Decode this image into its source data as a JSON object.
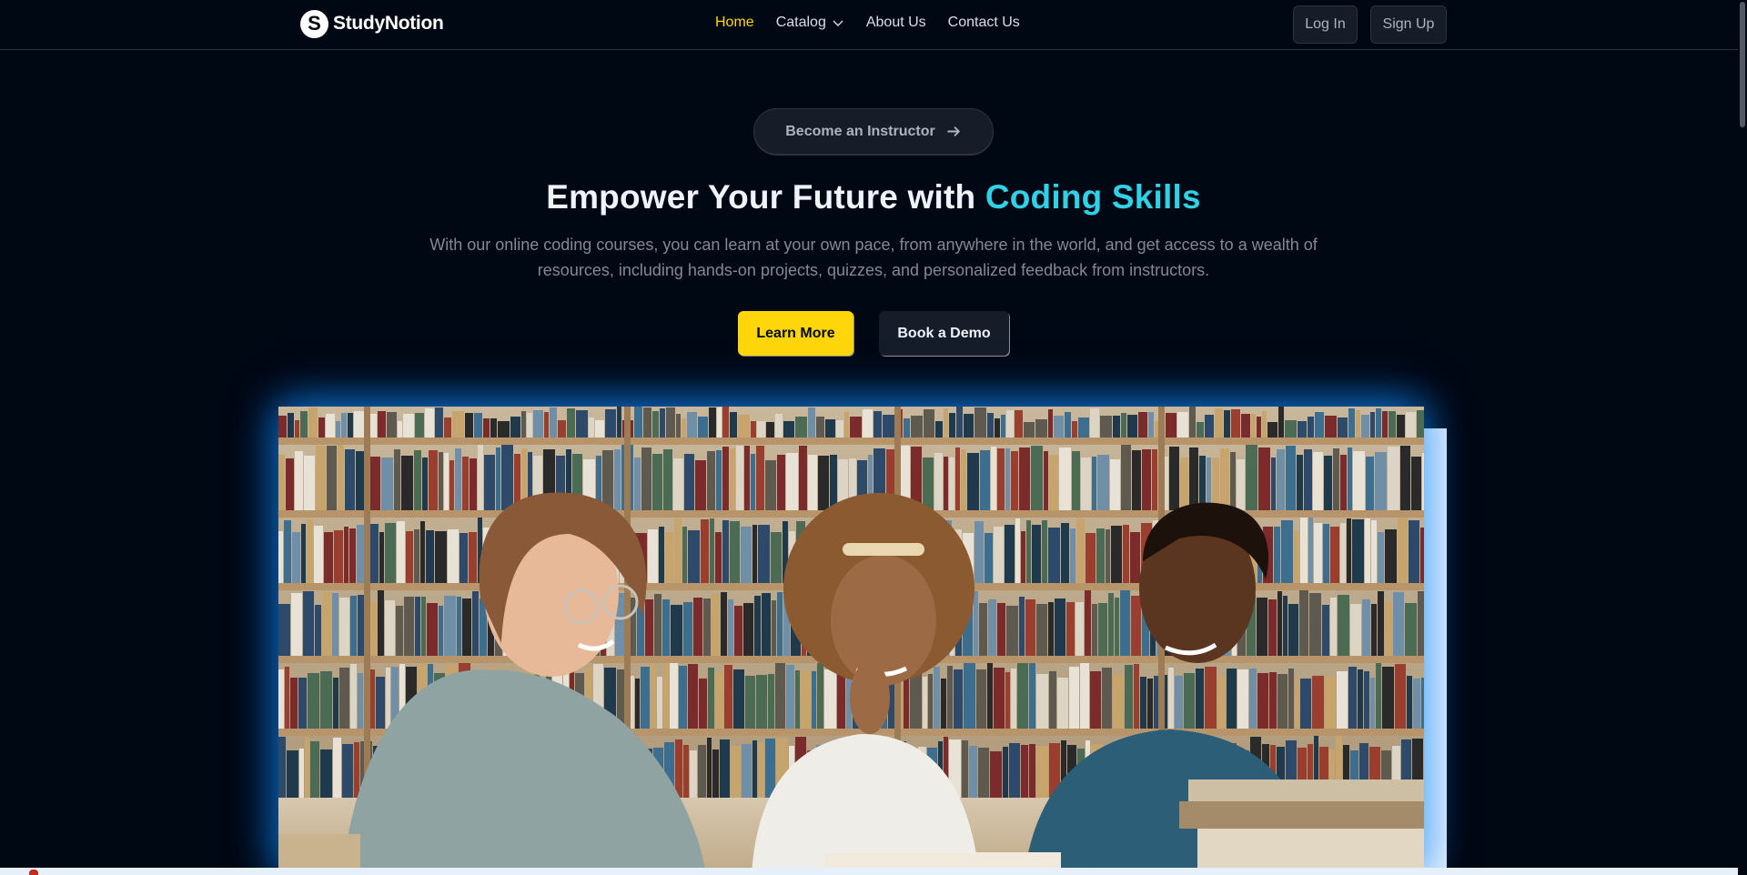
{
  "brand": {
    "logo_letter": "S",
    "name": "StudyNotion",
    "colors": {
      "background": "#000814",
      "accent_yellow": "#FFD60A",
      "accent_cyan": "#30D0E6",
      "glow_blue": "#128CFF"
    }
  },
  "nav": {
    "links": [
      {
        "label": "Home",
        "active": true
      },
      {
        "label": "Catalog",
        "active": false,
        "icon": "chevron-down-icon"
      },
      {
        "label": "About Us",
        "active": false
      },
      {
        "label": "Contact Us",
        "active": false
      }
    ],
    "login_label": "Log In",
    "signup_label": "Sign Up"
  },
  "hero": {
    "instructor_button": {
      "label": "Become an Instructor",
      "icon": "arrow-right-icon"
    },
    "headline_prefix": "Empower Your Future with",
    "headline_highlight": "Coding Skills",
    "subtext": "With our online coding courses, you can learn at your own pace, from anywhere in the world, and get access to a wealth of resources, including hands-on projects, quizzes, and personalized feedback from instructors.",
    "primary_cta": "Learn More",
    "secondary_cta": "Book a Demo",
    "image_alt": "three students reading in a library"
  }
}
